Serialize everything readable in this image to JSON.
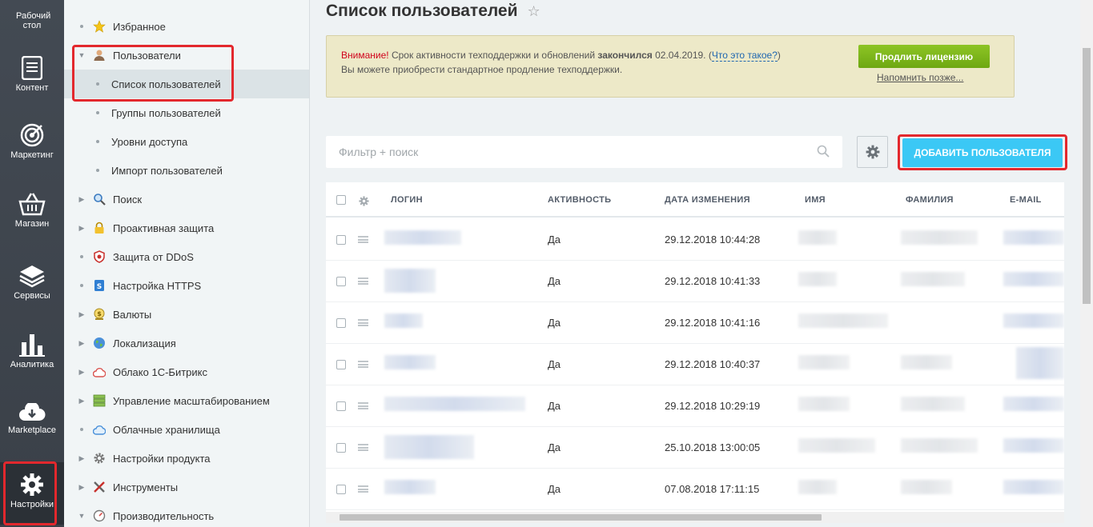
{
  "leftbar": {
    "items": [
      {
        "label": "Рабочий стол",
        "icon": "desktop-icon"
      },
      {
        "label": "Контент",
        "icon": "document-icon"
      },
      {
        "label": "Маркетинг",
        "icon": "target-icon"
      },
      {
        "label": "Магазин",
        "icon": "basket-icon"
      },
      {
        "label": "Сервисы",
        "icon": "layers-icon"
      },
      {
        "label": "Аналитика",
        "icon": "bar-chart-icon"
      },
      {
        "label": "Marketplace",
        "icon": "cloud-download-icon"
      },
      {
        "label": "Настройки",
        "icon": "gear-icon"
      }
    ]
  },
  "menu": {
    "items": [
      {
        "label": "Избранное",
        "icon": "star-icon",
        "type": "dot"
      },
      {
        "label": "Пользователи",
        "icon": "user-icon",
        "type": "expanded"
      },
      {
        "label": "Список пользователей",
        "type": "sub",
        "selected": true
      },
      {
        "label": "Группы пользователей",
        "type": "sub"
      },
      {
        "label": "Уровни доступа",
        "type": "sub"
      },
      {
        "label": "Импорт пользователей",
        "type": "sub"
      },
      {
        "label": "Поиск",
        "icon": "magnifier-icon",
        "type": "collapsed"
      },
      {
        "label": "Проактивная защита",
        "icon": "lock-icon",
        "type": "collapsed"
      },
      {
        "label": "Защита от DDoS",
        "icon": "shield-icon",
        "type": "dot"
      },
      {
        "label": "Настройка HTTPS",
        "icon": "https-lock-icon",
        "type": "dot"
      },
      {
        "label": "Валюты",
        "icon": "coin-icon",
        "type": "collapsed"
      },
      {
        "label": "Локализация",
        "icon": "globe-icon",
        "type": "collapsed"
      },
      {
        "label": "Облако 1С-Битрикс",
        "icon": "cloud-bitrix-icon",
        "type": "collapsed"
      },
      {
        "label": "Управление масштабированием",
        "icon": "server-icon",
        "type": "collapsed"
      },
      {
        "label": "Облачные хранилища",
        "icon": "cloud-storage-icon",
        "type": "dot"
      },
      {
        "label": "Настройки продукта",
        "icon": "cog-icon",
        "type": "collapsed"
      },
      {
        "label": "Инструменты",
        "icon": "tools-icon",
        "type": "collapsed"
      },
      {
        "label": "Производительность",
        "icon": "speedometer-icon",
        "type": "expanded"
      }
    ]
  },
  "page": {
    "title": "Список пользователей"
  },
  "notice": {
    "warn": "Внимание!",
    "text1": " Срок активности техподдержки и обновлений ",
    "bold": "закончился",
    "date": " 02.04.2019. (",
    "link": "Что это такое?",
    "close_paren": ")",
    "line2": "Вы можете приобрести стандартное продление техподдержки.",
    "button": "Продлить лицензию",
    "remind": "Напомнить позже..."
  },
  "toolbar": {
    "search_placeholder": "Фильтр + поиск",
    "add_button": "ДОБАВИТЬ ПОЛЬЗОВАТЕЛЯ"
  },
  "table": {
    "columns": [
      "ЛОГИН",
      "АКТИВНОСТЬ",
      "ДАТА ИЗМЕНЕНИЯ",
      "ИМЯ",
      "ФАМИЛИЯ",
      "E-MAIL"
    ],
    "rows": [
      {
        "active": "Да",
        "modified": "29.12.2018 10:44:28"
      },
      {
        "active": "Да",
        "modified": "29.12.2018 10:41:33"
      },
      {
        "active": "Да",
        "modified": "29.12.2018 10:41:16"
      },
      {
        "active": "Да",
        "modified": "29.12.2018 10:40:37"
      },
      {
        "active": "Да",
        "modified": "29.12.2018 10:29:19"
      },
      {
        "active": "Да",
        "modified": "25.10.2018 13:00:05"
      },
      {
        "active": "Да",
        "modified": "07.08.2018 17:11:15"
      }
    ]
  },
  "colors": {
    "accent_blue": "#3bc8f5",
    "green_button": "#7ab51d",
    "highlight_red": "#e3282d"
  }
}
